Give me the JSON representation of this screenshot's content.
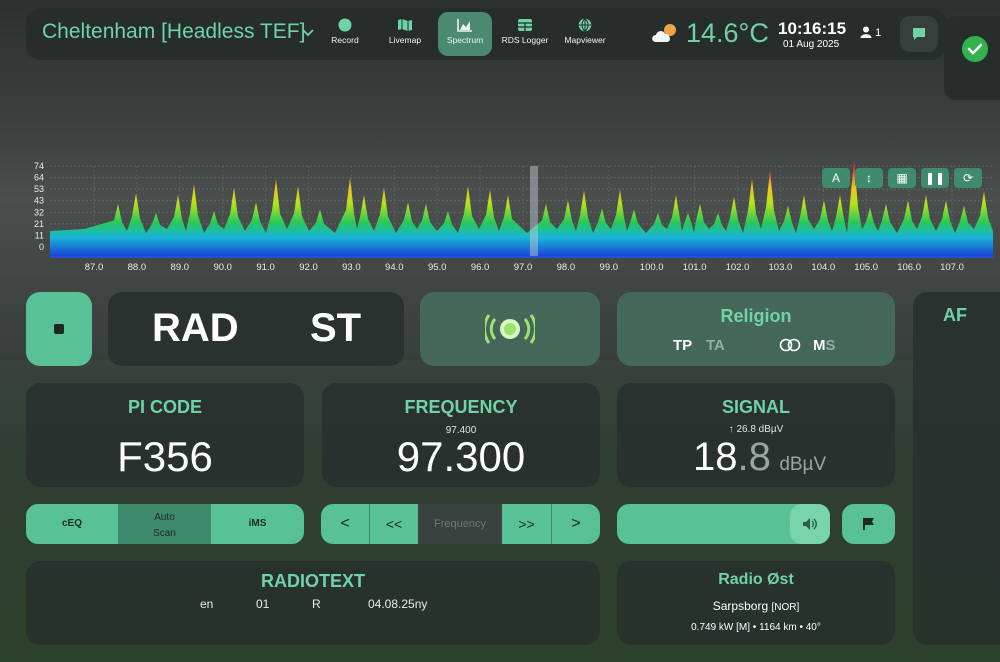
{
  "header": {
    "station": "Cheltenham [Headless TEF]",
    "nav": [
      {
        "label": "Record",
        "icon": "record-icon"
      },
      {
        "label": "Livemap",
        "icon": "map-icon"
      },
      {
        "label": "Spectrum",
        "icon": "chart-icon",
        "active": true
      },
      {
        "label": "RDS Logger",
        "icon": "table-icon"
      },
      {
        "label": "Mapviewer",
        "icon": "globe-icon"
      }
    ],
    "temperature": "14.6°C",
    "time": "10:16:15",
    "date": "01 Aug 2025",
    "users": "1"
  },
  "spectrum": {
    "y_ticks": [
      "74",
      "64",
      "53",
      "43",
      "32",
      "21",
      "11",
      "0"
    ],
    "x_ticks": [
      "87.0",
      "88.0",
      "89.0",
      "90.0",
      "91.0",
      "92.0",
      "93.0",
      "94.0",
      "95.0",
      "96.0",
      "97.0",
      "98.0",
      "99.0",
      "100.0",
      "101.0",
      "102.0",
      "103.0",
      "104.0",
      "105.0",
      "106.0",
      "107.0"
    ],
    "tools": [
      "A",
      "↕",
      "▦",
      "❚❚",
      "⟳"
    ]
  },
  "rds": {
    "ps_left": "RAD",
    "ps_right": "ST",
    "pty": "Religion",
    "flags": {
      "tp": "TP",
      "ta": "TA",
      "m": "M",
      "s": "S"
    },
    "af_label": "AF"
  },
  "pi": {
    "title": "PI CODE",
    "value": "F356"
  },
  "frequency": {
    "title": "FREQUENCY",
    "previous": "97.400",
    "value": "97.300"
  },
  "signal": {
    "title": "SIGNAL",
    "peak": "26.8 dBµV",
    "value_int": "18",
    "value_dec": ".8",
    "unit": "dBµV"
  },
  "controls": {
    "ceq": "cEQ",
    "autoscan_1": "Auto",
    "autoscan_2": "Scan",
    "ims": "iMS",
    "freq_placeholder": "Frequency",
    "prev": "<",
    "fast_prev": "<<",
    "fast_next": ">>",
    "next": ">"
  },
  "radiotext": {
    "title": "RADIOTEXT",
    "line": [
      "en",
      "01",
      "R",
      "04.08.25ny"
    ]
  },
  "tx": {
    "name": "Radio Øst",
    "city": "Sarpsborg",
    "country": "[NOR]",
    "details": "0.749 kW [M] • 1164 km • 40°"
  }
}
